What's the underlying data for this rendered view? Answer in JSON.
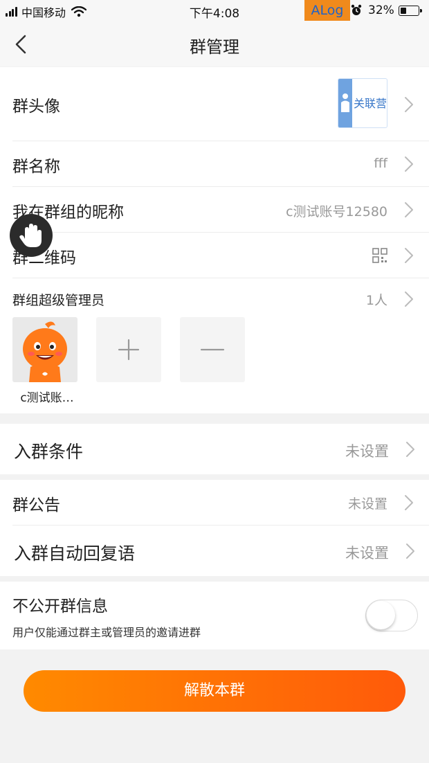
{
  "status_bar": {
    "carrier": "中国移动",
    "time": "下午4:08",
    "alog_label": "ALog",
    "battery_percent": "32%",
    "battery_level": 0.32
  },
  "nav": {
    "title": "群管理",
    "back_icon": "chevron-left-icon"
  },
  "section1": {
    "avatar_label": "群头像",
    "avatar_image_text": "关联营销",
    "name_label": "群名称",
    "name_value": "fff",
    "nickname_label": "我在群组的昵称",
    "nickname_value": "c测试账号12580",
    "qrcode_label": "群二维码",
    "qrcode_icon": "qrcode-icon",
    "admin_label": "群组超级管理员",
    "admin_count": "1人",
    "admins": [
      {
        "caption": "c测试账…"
      }
    ],
    "add_admin_icon": "plus-icon",
    "remove_admin_icon": "minus-icon"
  },
  "section2": {
    "join_condition_label": "入群条件",
    "join_condition_value": "未设置"
  },
  "section3": {
    "notice_label": "群公告",
    "notice_value": "未设置",
    "auto_reply_label": "入群自动回复语",
    "auto_reply_value": "未设置"
  },
  "section4": {
    "private_label": "不公开群信息",
    "private_desc": "用户仅能通过群主或管理员的邀请进群",
    "private_enabled": false
  },
  "dissolve_button": "解散本群",
  "colors": {
    "accent_start": "#ff8a00",
    "accent_end": "#ff5a0a",
    "alog_bg": "#f08a1c"
  }
}
